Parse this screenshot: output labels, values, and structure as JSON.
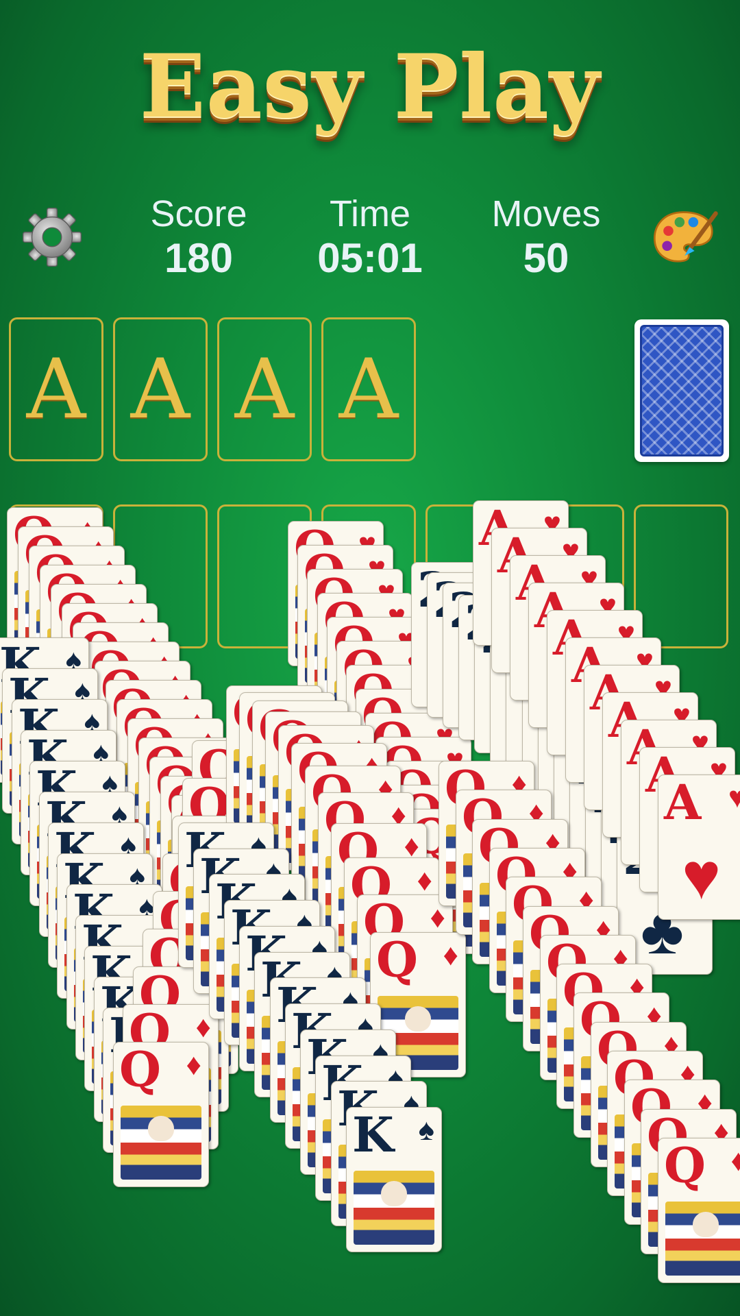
{
  "title": "Easy Play",
  "stats": {
    "score_label": "Score",
    "score_value": "180",
    "time_label": "Time",
    "time_value": "05:01",
    "moves_label": "Moves",
    "moves_value": "50"
  },
  "icons": {
    "settings": "gear-icon",
    "theme": "palette-icon"
  },
  "foundations": [
    {
      "label": "A"
    },
    {
      "label": "A"
    },
    {
      "label": "A"
    },
    {
      "label": "A"
    }
  ],
  "colors": {
    "felt": "#0f8a3a",
    "gold": "#e7c04b",
    "red_suit": "#d71c2a",
    "black_suit": "#102744"
  },
  "cascade": {
    "families": [
      {
        "rank": "K",
        "suit": "♠",
        "color": "black"
      },
      {
        "rank": "Q",
        "suit": "♦",
        "color": "red"
      },
      {
        "rank": "Q",
        "suit": "♥",
        "color": "red"
      },
      {
        "rank": "A",
        "suit": "♥",
        "color": "red"
      },
      {
        "rank": "2",
        "suit": "♣",
        "color": "black"
      }
    ]
  }
}
